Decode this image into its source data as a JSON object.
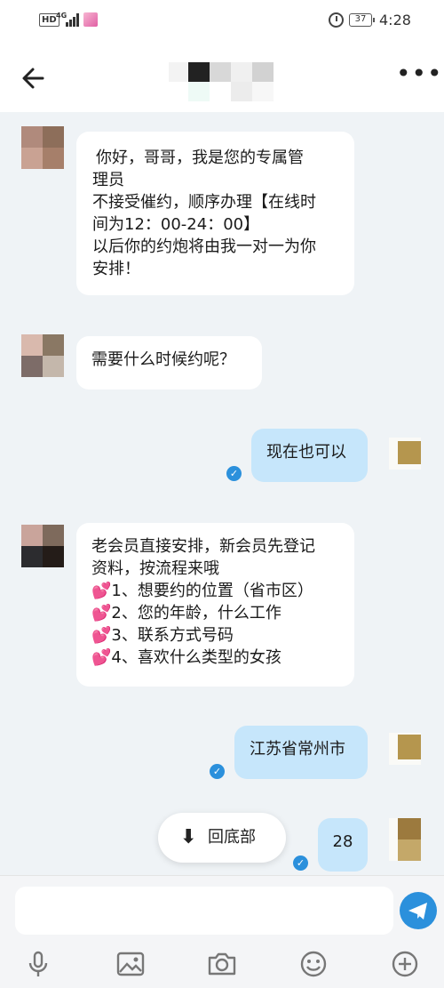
{
  "status_bar": {
    "hd": "HD",
    "network": "4G",
    "battery": "37",
    "time": "4:28"
  },
  "header": {
    "back_icon": "arrow-left-icon",
    "more_icon": "more-dots-icon",
    "more_label": "•••"
  },
  "messages": [
    {
      "side": "in",
      "lines": [
        "你好，哥哥，我是您的专属管",
        "理员",
        "不接受催约，顺序办理【在线时",
        "间为12：00-24：00】",
        "以后你的约炮将由我一对一为你",
        "安排！"
      ]
    },
    {
      "side": "in",
      "lines": [
        "需要什么时候约呢？"
      ]
    },
    {
      "side": "out",
      "lines": [
        "现在也可以"
      ],
      "read": true
    },
    {
      "side": "in",
      "lines": [
        "老会员直接安排，新会员先登记",
        "资料，按流程来哦",
        "💕1、想要约的位置（省市区）",
        "💕2、您的年龄，什么工作",
        "💕3、联系方式号码",
        "💕4、喜欢什么类型的女孩"
      ]
    },
    {
      "side": "out",
      "lines": [
        "江苏省常州市"
      ],
      "read": true
    },
    {
      "side": "out",
      "lines": [
        "28"
      ],
      "read": true
    }
  ],
  "scroll_to_bottom": {
    "icon": "arrow-down-icon",
    "arrow": "⬇",
    "label": "回底部"
  },
  "composer": {
    "placeholder": "",
    "send_icon": "paper-plane-icon",
    "tools": [
      "microphone-icon",
      "image-icon",
      "camera-icon",
      "emoji-icon",
      "plus-icon"
    ]
  },
  "colors": {
    "chat_background": "#eff3f6",
    "incoming_bubble": "#ffffff",
    "outgoing_bubble": "#c6e6fb",
    "accent": "#2b90dc"
  }
}
